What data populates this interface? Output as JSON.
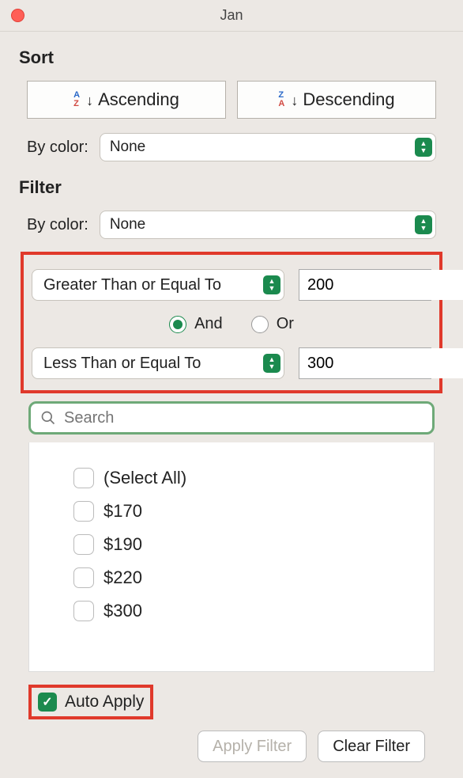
{
  "window": {
    "title": "Jan"
  },
  "sort": {
    "heading": "Sort",
    "asc_label": "Ascending",
    "desc_label": "Descending",
    "by_color_label": "By color:",
    "by_color_value": "None"
  },
  "filter": {
    "heading": "Filter",
    "by_color_label": "By color:",
    "by_color_value": "None",
    "criteria": [
      {
        "operator": "Greater Than or Equal To",
        "value": "200"
      },
      {
        "operator": "Less Than or Equal To",
        "value": "300"
      }
    ],
    "logic": {
      "and": "And",
      "or": "Or",
      "selected": "and"
    },
    "search_placeholder": "Search",
    "items": [
      {
        "label": "(Select All)",
        "checked": false
      },
      {
        "label": "$170",
        "checked": false
      },
      {
        "label": "$190",
        "checked": false
      },
      {
        "label": "$220",
        "checked": false
      },
      {
        "label": "$300",
        "checked": false
      }
    ],
    "auto_apply": {
      "label": "Auto Apply",
      "checked": true
    }
  },
  "buttons": {
    "apply": "Apply Filter",
    "clear": "Clear Filter"
  }
}
